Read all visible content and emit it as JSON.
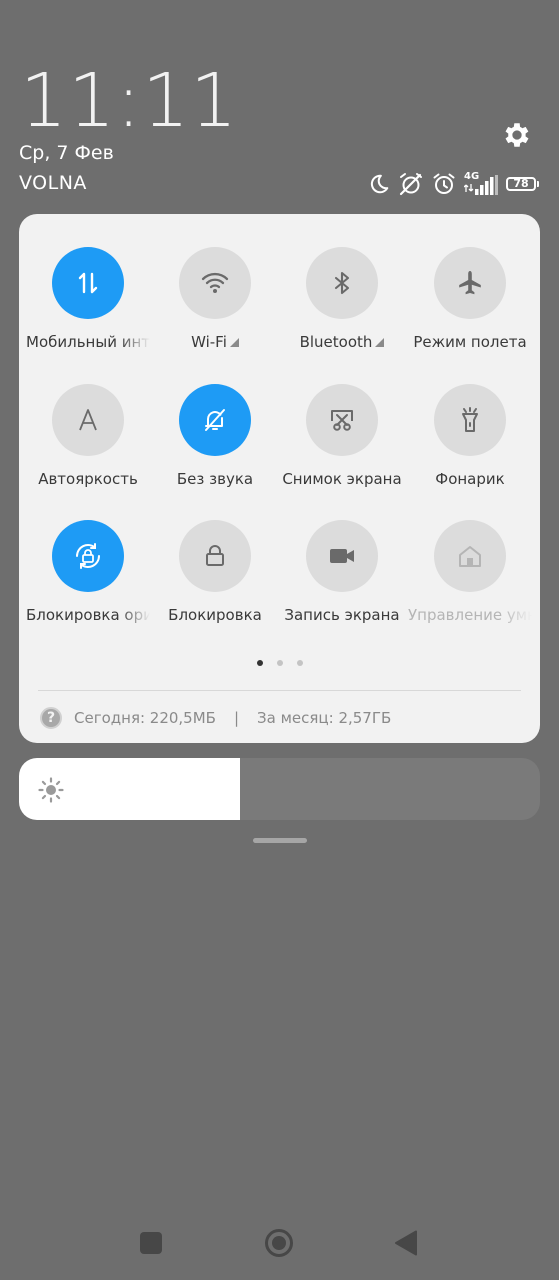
{
  "status": {
    "time": "11:11",
    "date": "Ср, 7 Фев",
    "carrier": "VOLNA",
    "network": "4G",
    "battery": "78",
    "icons": [
      "moon-icon",
      "alarm-off-icon",
      "alarm-icon",
      "signal-icon",
      "battery-icon"
    ]
  },
  "tiles": [
    {
      "label": "Мобильный интернет",
      "icon": "mobile-data-icon",
      "on": true
    },
    {
      "label": "Wi-Fi",
      "icon": "wifi-icon",
      "on": false,
      "expand": true
    },
    {
      "label": "Bluetooth",
      "icon": "bluetooth-icon",
      "on": false,
      "expand": true
    },
    {
      "label": "Режим полета",
      "icon": "airplane-icon",
      "on": false
    },
    {
      "label": "Автояркость",
      "icon": "auto-brightness-icon",
      "on": false
    },
    {
      "label": "Без звука",
      "icon": "silent-bell-icon",
      "on": true
    },
    {
      "label": "Снимок экрана",
      "icon": "screenshot-scissors-icon",
      "on": false
    },
    {
      "label": "Фонарик",
      "icon": "flashlight-icon",
      "on": false
    },
    {
      "label": "Блокировка ориентации",
      "icon": "rotation-lock-icon",
      "on": true
    },
    {
      "label": "Блокировка",
      "icon": "lock-icon",
      "on": false
    },
    {
      "label": "Запись экрана",
      "icon": "video-camera-icon",
      "on": false
    },
    {
      "label": "Управление умным домом",
      "icon": "home-icon",
      "on": false,
      "disabled": true
    }
  ],
  "pages": {
    "count": 3,
    "active": 0
  },
  "usage": {
    "today": "Сегодня: 220,5МБ",
    "separator": "|",
    "month": "За месяц: 2,57ГБ"
  },
  "brightness": {
    "level": 0.425
  },
  "colors": {
    "accent": "#1e9bf5",
    "panel": "#f2f2f2",
    "background": "#6e6e6e"
  }
}
